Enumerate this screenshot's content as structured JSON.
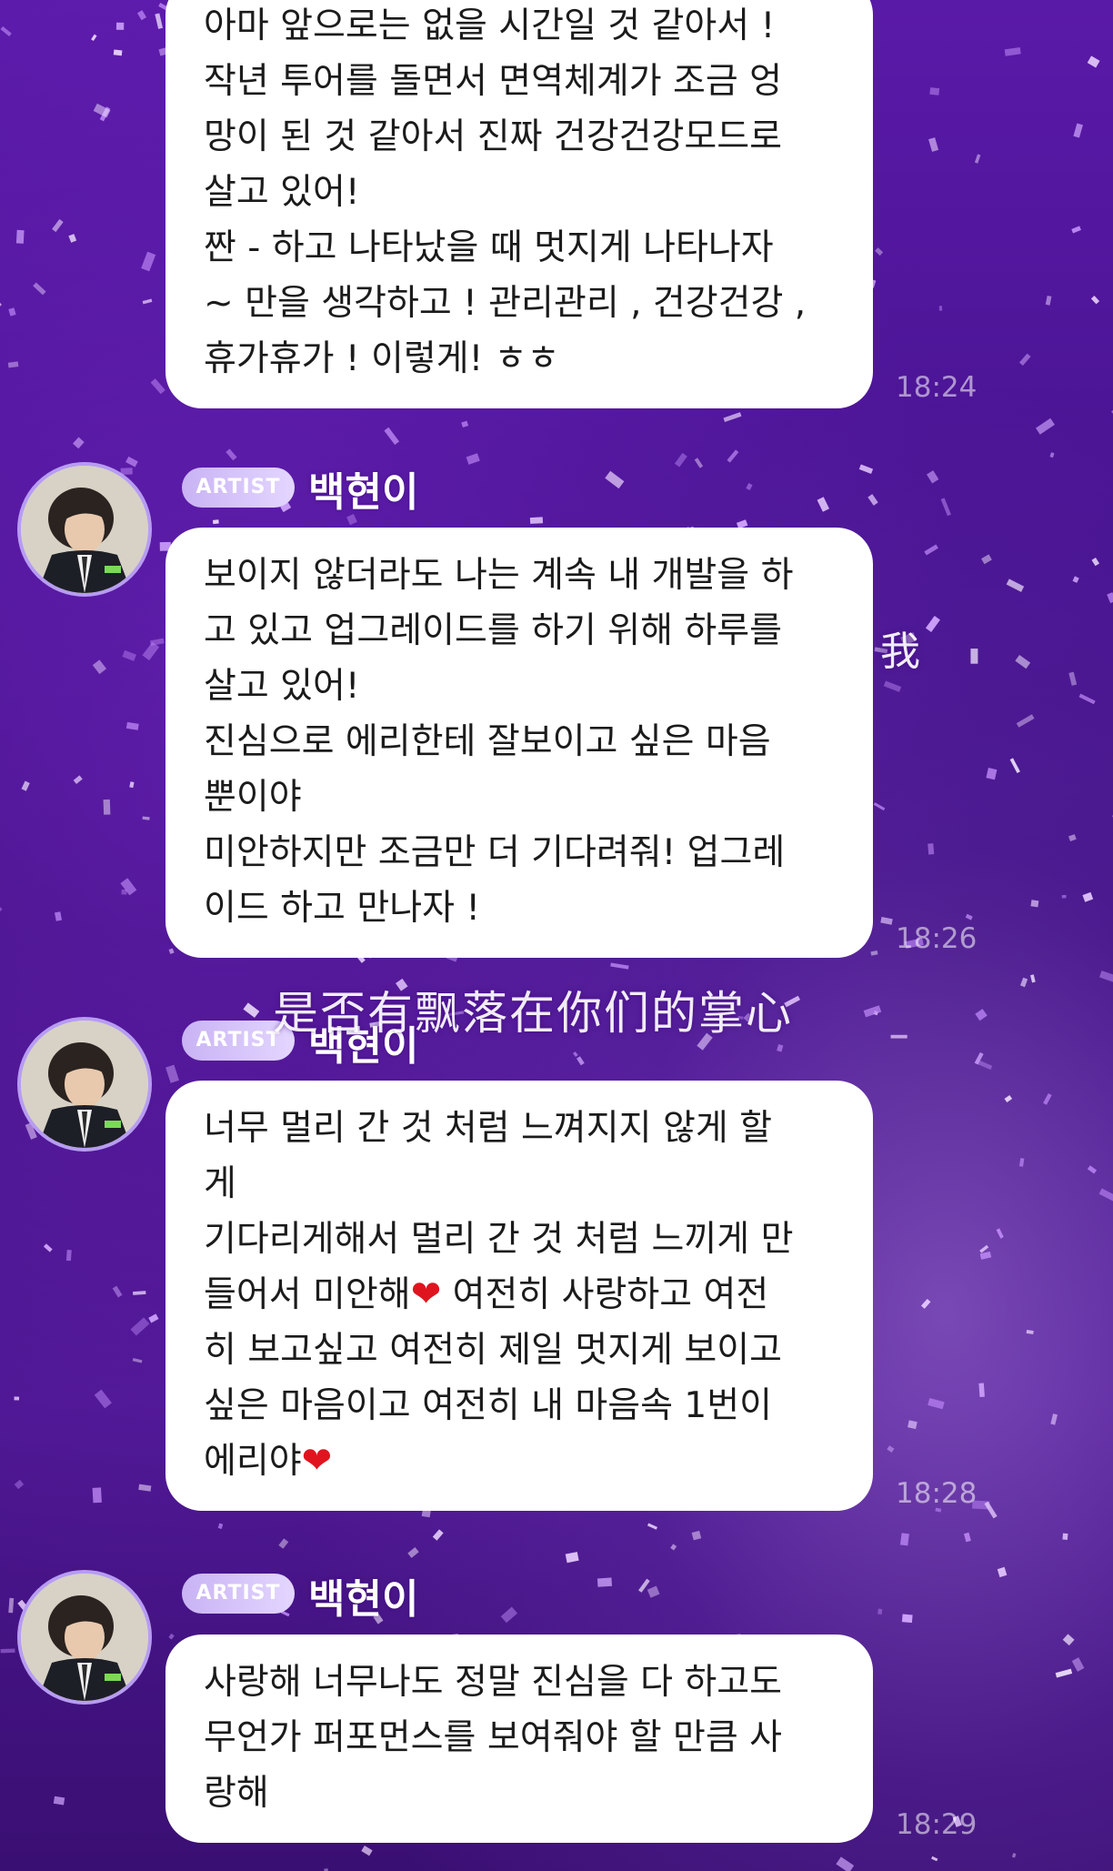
{
  "background": {
    "primary_color": "#4a1494",
    "confetti_color": "#d8b6ff"
  },
  "watermarks": {
    "top_right": "我",
    "caption": "是否有飘落在你们的掌心"
  },
  "messages": [
    {
      "type": "continuation",
      "lines": [
        "아마 앞으로는 없을 시간일 것 같아서 !",
        "작년 투어를 돌면서 면역체계가 조금 엉",
        "망이 된 것 같아서 진짜 건강건강모드로",
        "살고 있어!",
        "짠 - 하고 나타났을 때 멋지게 나타나자",
        "~ 만을 생각하고 ! 관리관리 , 건강건강 ,",
        "휴가휴가 ! 이렇게! ㅎㅎ"
      ],
      "time": "18:24"
    },
    {
      "type": "artist",
      "badge": "ARTIST",
      "sender": "백현이",
      "lines": [
        "보이지 않더라도 나는 계속 내 개발을 하",
        "고 있고 업그레이드를 하기 위해 하루를",
        "살고 있어!",
        "진심으로 에리한테 잘보이고 싶은 마음",
        "뿐이야",
        "미안하지만 조금만 더 기다려줘! 업그레",
        "이드 하고 만나자 !"
      ],
      "time": "18:26"
    },
    {
      "type": "artist",
      "badge": "ARTIST",
      "sender": "백현이",
      "lines": [
        "너무 멀리 간 것 처럼 느껴지지 않게 할",
        "게",
        "기다리게해서 멀리 간 것 처럼 느끼게 만",
        "들어서 미안해",
        "히 보고싶고 여전히 제일 멋지게 보이고",
        "싶은 마음이고 여전히 내 마음속 1번이",
        "에리야"
      ],
      "line4_after_heart": " 여전히 사랑하고 여전",
      "heart_icon": "❤",
      "time": "18:28"
    },
    {
      "type": "artist",
      "badge": "ARTIST",
      "sender": "백현이",
      "lines": [
        "사랑해 너무나도 정말 진심을 다 하고도",
        "무언가 퍼포먼스를 보여줘야 할 만큼 사",
        "랑해"
      ],
      "time": "18:29"
    }
  ]
}
